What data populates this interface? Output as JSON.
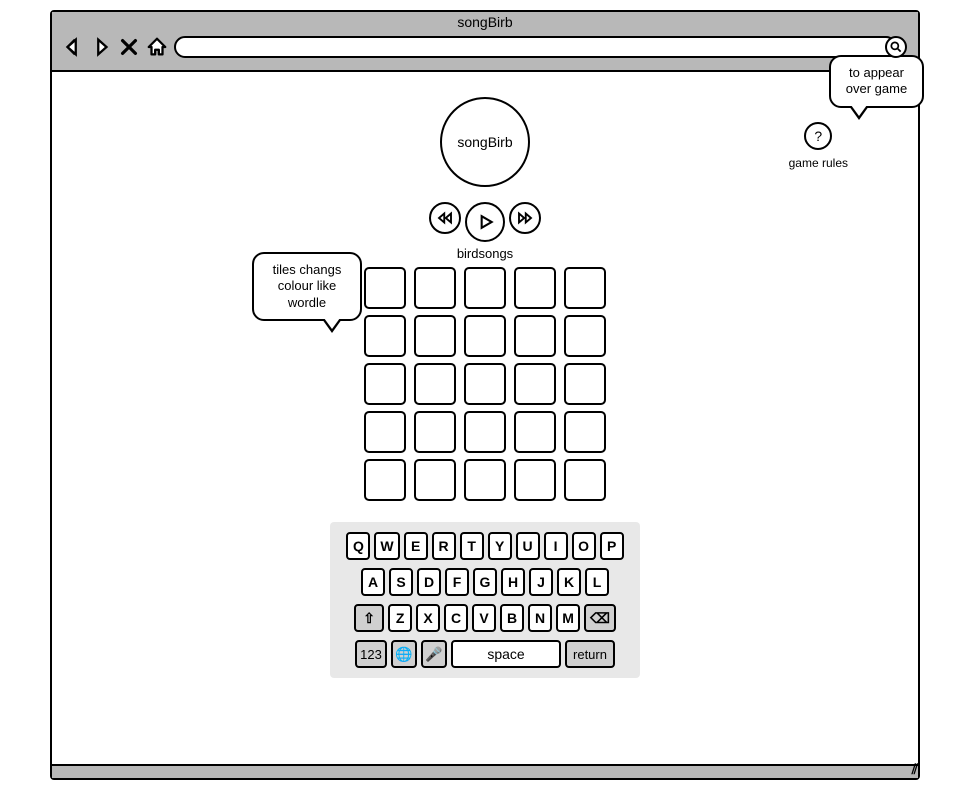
{
  "window": {
    "title": "songBirb"
  },
  "logo": {
    "text": "songBirb"
  },
  "player": {
    "label": "birdsongs",
    "icons": {
      "rewind": "rewind-icon",
      "play": "play-icon",
      "forward": "fast-forward-icon"
    }
  },
  "help": {
    "symbol": "?",
    "label": "game rules"
  },
  "callouts": {
    "tiles": "tiles changs\ncolour like\nwordle",
    "overlay": "to appear\nover game"
  },
  "grid": {
    "rows": 5,
    "cols": 5
  },
  "keyboard": {
    "row1": [
      "Q",
      "W",
      "E",
      "R",
      "T",
      "Y",
      "U",
      "I",
      "O",
      "P"
    ],
    "row2": [
      "A",
      "S",
      "D",
      "F",
      "G",
      "H",
      "J",
      "K",
      "L"
    ],
    "row3": [
      "⇧",
      "Z",
      "X",
      "C",
      "V",
      "B",
      "N",
      "M",
      "⌫"
    ],
    "row4": {
      "num": "123",
      "globe": "🌐",
      "mic": "🎤",
      "space": "space",
      "return": "return"
    }
  }
}
